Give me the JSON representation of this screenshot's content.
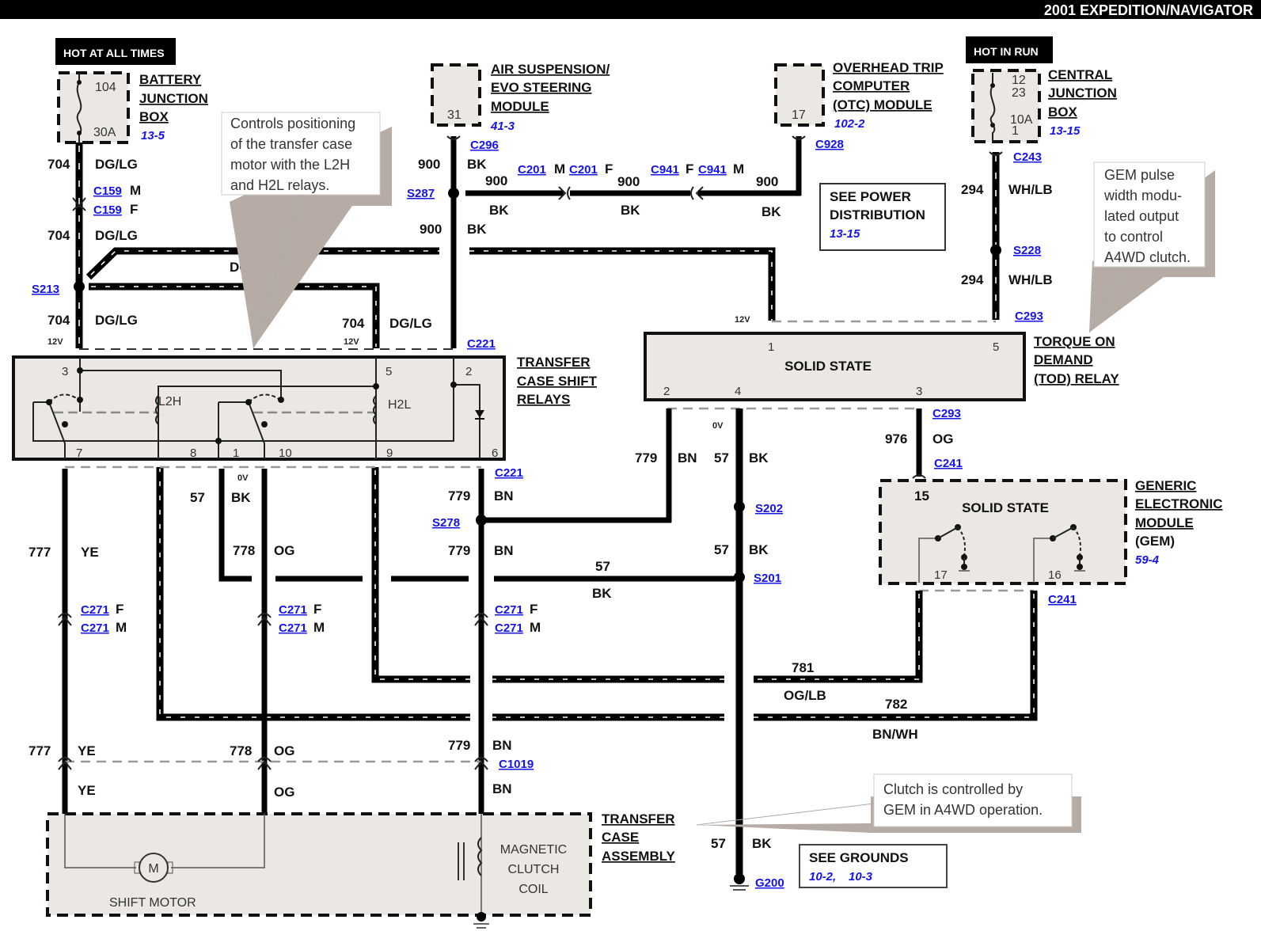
{
  "header": {
    "title": "2001 EXPEDITION/NAVIGATOR"
  },
  "power": {
    "hot_at_all_times": "HOT AT ALL TIMES",
    "hot_in_run": "HOT IN RUN"
  },
  "components": {
    "battery_junction_box": {
      "lines": [
        "BATTERY",
        "JUNCTION",
        "BOX"
      ],
      "ref": "13-5",
      "fuse_number": "104",
      "fuse_rating": "30A"
    },
    "air_suspension": {
      "lines": [
        "AIR SUSPENSION/",
        "EVO STEERING",
        "MODULE"
      ],
      "ref": "41-3",
      "pin": "31"
    },
    "otc_module": {
      "lines": [
        "OVERHEAD TRIP",
        "COMPUTER",
        "(OTC) MODULE"
      ],
      "ref": "102-2",
      "pin": "17"
    },
    "central_junction_box": {
      "lines": [
        "CENTRAL",
        "JUNCTION",
        "BOX"
      ],
      "ref": "13-15",
      "pins_top": [
        "12",
        "23"
      ],
      "fuse_rating": "10A",
      "pin_bottom": "1"
    },
    "transfer_case_shift_relays": {
      "lines": [
        "TRANSFER",
        "CASE SHIFT",
        "RELAYS"
      ],
      "relay_left": "L2H",
      "relay_right": "H2L",
      "pins": [
        "3",
        "5",
        "2",
        "7",
        "8",
        "1",
        "10",
        "9",
        "6"
      ]
    },
    "tod_relay": {
      "lines": [
        "TORQUE ON",
        "DEMAND",
        "(TOD) RELAY"
      ],
      "body": "SOLID STATE",
      "pins": [
        "1",
        "5",
        "2",
        "4",
        "3"
      ]
    },
    "gem": {
      "lines": [
        "GENERIC",
        "ELECTRONIC",
        "MODULE",
        "(GEM)"
      ],
      "ref": "59-4",
      "body": "SOLID STATE",
      "pins": [
        "15",
        "17",
        "16"
      ]
    },
    "transfer_case_assembly": {
      "lines": [
        "TRANSFER",
        "CASE",
        "ASSEMBLY"
      ],
      "shift_motor": "SHIFT MOTOR",
      "motor_symbol": "M",
      "clutch": [
        "MAGNETIC",
        "CLUTCH",
        "COIL"
      ]
    }
  },
  "see_boxes": {
    "power_distribution": {
      "lines": [
        "SEE POWER",
        "DISTRIBUTION"
      ],
      "ref": "13-15"
    },
    "grounds": {
      "title": "SEE GROUNDS",
      "refs": [
        "10-2,",
        "10-3"
      ]
    }
  },
  "callouts": {
    "relays": [
      "Controls positioning",
      "of the transfer case",
      "motor with the L2H",
      "and H2L relays."
    ],
    "gem": [
      "GEM pulse",
      "width modu-",
      "lated output",
      "to control",
      "A4WD clutch."
    ],
    "clutch": [
      "Clutch is controlled by",
      "GEM in A4WD operation."
    ]
  },
  "connectors": {
    "c159m": "C159",
    "c159f": "C159",
    "m": "M",
    "f": "F",
    "c296": "C296",
    "c201m": "C201",
    "c201f": "C201",
    "c941f": "C941",
    "c941m": "C941",
    "c928": "C928",
    "c243": "C243",
    "c293": "C293",
    "c221": "C221",
    "c241": "C241",
    "c271": "C271",
    "c1019": "C1019"
  },
  "splices": {
    "s213": "S213",
    "s287": "S287",
    "s228": "S228",
    "s278": "S278",
    "s202": "S202",
    "s201": "S201",
    "g200": "G200"
  },
  "voltages": {
    "v12": "12V",
    "v0": "0V"
  },
  "wires": {
    "w704": {
      "circuit": "704",
      "color": "DG/LG"
    },
    "w900": {
      "circuit": "900",
      "color": "BK"
    },
    "w294": {
      "circuit": "294",
      "color": "WH/LB"
    },
    "w777": {
      "circuit": "777",
      "color": "YE"
    },
    "w57": {
      "circuit": "57",
      "color": "BK"
    },
    "w778": {
      "circuit": "778",
      "color": "OG"
    },
    "w779": {
      "circuit": "779",
      "color": "BN"
    },
    "w976": {
      "circuit": "976",
      "color": "OG"
    },
    "w781": {
      "circuit": "781",
      "color": "OG/LB"
    },
    "w782": {
      "circuit": "782",
      "color": "BN/WH"
    }
  }
}
